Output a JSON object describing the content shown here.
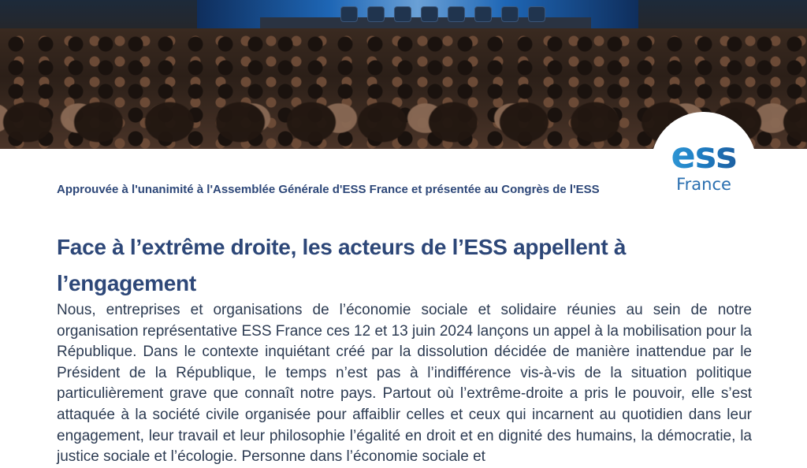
{
  "logo": {
    "ess": "ess",
    "france": "France"
  },
  "article": {
    "subtitle": "Approuvée à l'unanimité à l'Assemblée Générale d'ESS France et présentée au Congrès de l'ESS",
    "headline": "Face à l’extrême droite, les acteurs de l’ESS appellent à l’engagement",
    "body": "Nous, entreprises et organisations de l’économie sociale et solidaire réunies au sein de notre organisation représentative ESS France ces 12 et 13 juin 2024 lançons un appel à la mobilisation pour la République. Dans le contexte inquiétant créé par la dissolution décidée de manière inattendue par le Président de la République, le temps n’est pas à l’indifférence vis-à-vis de la situation politique particulièrement grave que connaît notre pays. Partout où l’extrême-droite a pris le pouvoir, elle s’est attaquée à la société civile organisée pour affaiblir celles et ceux qui incarnent au quotidien dans leur engagement, leur travail et leur philosophie l’égalité en droit et en dignité des humains, la démocratie, la justice sociale et l’écologie. Personne dans l’économie sociale et"
  },
  "colors": {
    "heading": "#2d4778",
    "body_text": "#2c3b52",
    "logo_blue": "#1f7fc4"
  }
}
